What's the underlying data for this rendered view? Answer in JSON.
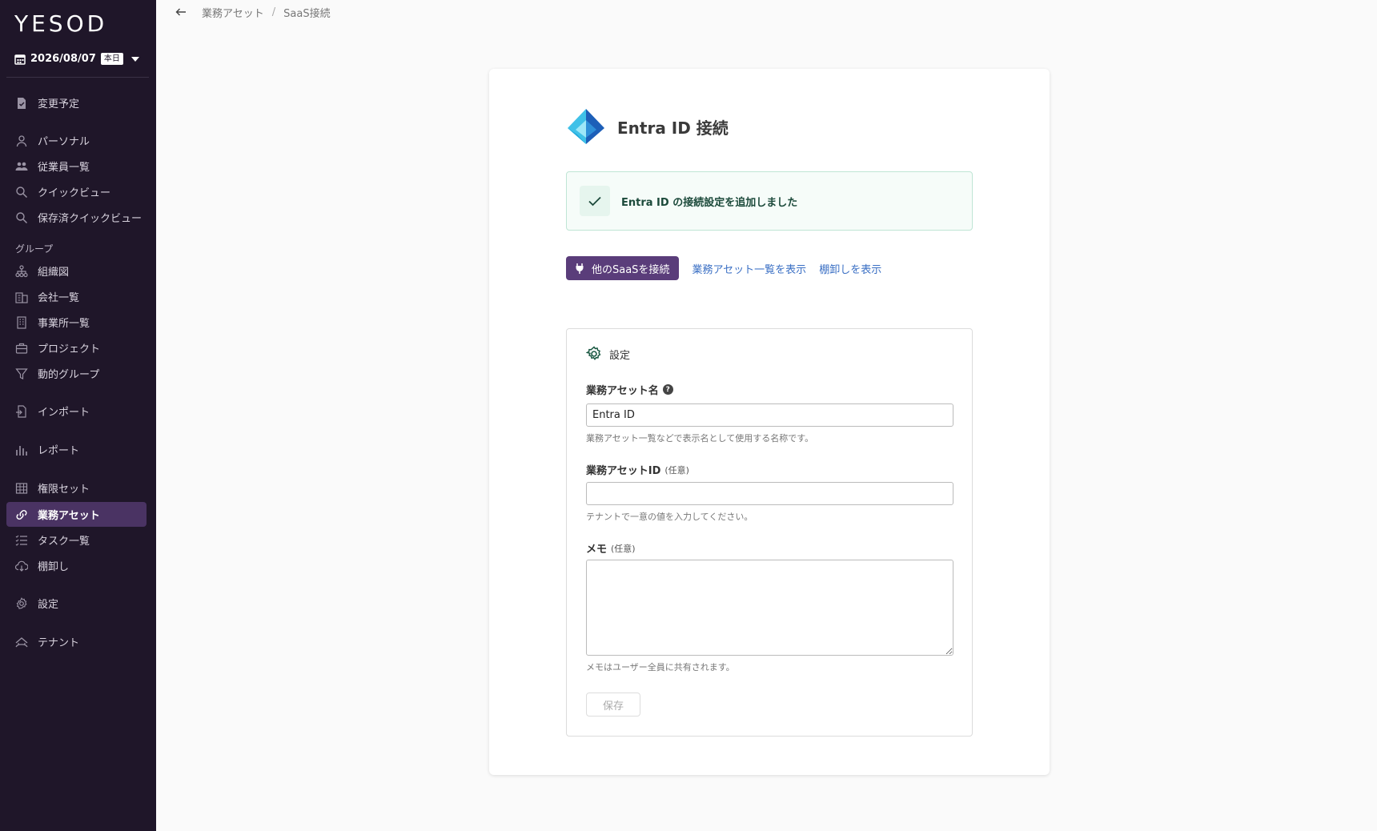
{
  "sidebar": {
    "logo": "YESOD",
    "date": "2026/08/07",
    "today_badge": "本日",
    "items": [
      {
        "label": "変更予定"
      },
      {
        "label": "パーソナル"
      },
      {
        "label": "従業員一覧"
      },
      {
        "label": "クイックビュー"
      },
      {
        "label": "保存済クイックビュー"
      },
      {
        "label": "組織図"
      },
      {
        "label": "会社一覧"
      },
      {
        "label": "事業所一覧"
      },
      {
        "label": "プロジェクト"
      },
      {
        "label": "動的グループ"
      },
      {
        "label": "インポート"
      },
      {
        "label": "レポート"
      },
      {
        "label": "権限セット"
      },
      {
        "label": "業務アセット"
      },
      {
        "label": "タスク一覧"
      },
      {
        "label": "棚卸し"
      },
      {
        "label": "設定"
      },
      {
        "label": "テナント"
      }
    ],
    "group_label": "グループ",
    "active_item": "業務アセット"
  },
  "breadcrumb": {
    "items": [
      "業務アセット",
      "SaaS接続"
    ],
    "separator": "/"
  },
  "card": {
    "title": "Entra ID 接続",
    "alert": "Entra ID の接続設定を追加しました",
    "connect_button": "他のSaaSを接続",
    "link_asset_list": "業務アセット一覧を表示",
    "link_inventory": "棚卸しを表示"
  },
  "settings": {
    "heading": "設定",
    "asset_name_label": "業務アセット名",
    "asset_name_value": "Entra ID",
    "asset_name_hint": "業務アセット一覧などで表示名として使用する名称です。",
    "asset_id_label": "業務アセットID",
    "optional": "(任意)",
    "asset_id_value": "",
    "asset_id_hint": "テナントで一意の値を入力してください。",
    "memo_label": "メモ",
    "memo_hint": "メモはユーザー全員に共有されます。",
    "save_button": "保存"
  },
  "colors": {
    "sidebar_bg": "#1f1629",
    "active_item_bg": "#4a3363",
    "primary_button": "#5a3d7a",
    "link": "#3a6fc4",
    "success_border": "#bfe5d5"
  }
}
